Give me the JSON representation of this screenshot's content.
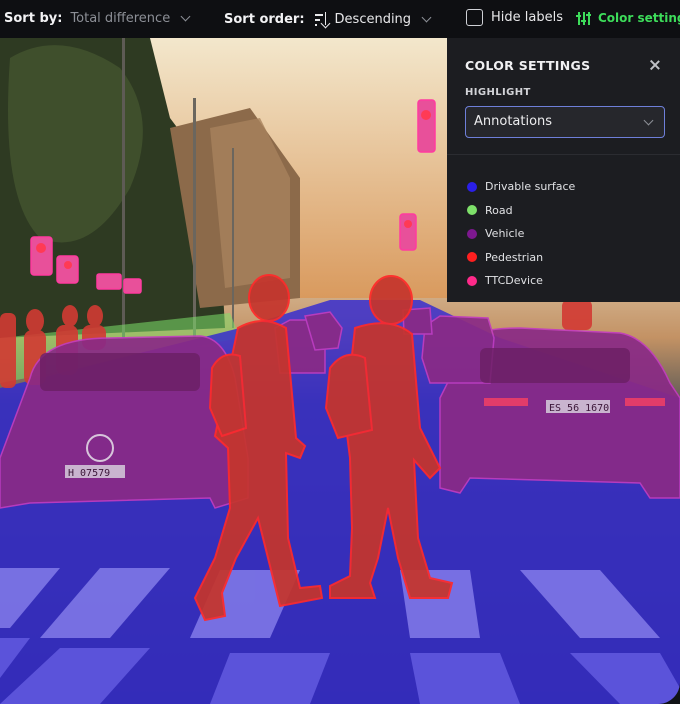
{
  "toolbar": {
    "sort_by_label": "Sort by:",
    "sort_by_value": "Total difference",
    "sort_order_label": "Sort order:",
    "sort_order_value": "Descending",
    "hide_labels": "Hide labels",
    "color_settings": "Color settings"
  },
  "panel": {
    "title": "COLOR SETTINGS",
    "highlight_label": "HIGHLIGHT",
    "highlight_value": "Annotations",
    "legend": [
      {
        "label": "Drivable surface",
        "color": "#2a1fe8"
      },
      {
        "label": "Road",
        "color": "#7ee06a"
      },
      {
        "label": "Vehicle",
        "color": "#7d188f"
      },
      {
        "label": "Pedestrian",
        "color": "#ff1f1f"
      },
      {
        "label": "TTCDevice",
        "color": "#ff2a8a"
      }
    ]
  },
  "scene": {
    "plates": [
      "ES 56 1670",
      "H 07579"
    ]
  },
  "colors": {
    "accent_green": "#3ddc5a",
    "select_border": "#6e7fd9",
    "drivable": "#3a30d8",
    "vehicle": "#8a2a86",
    "pedestrian": "#c5352d",
    "ttc": "#e8509a"
  }
}
